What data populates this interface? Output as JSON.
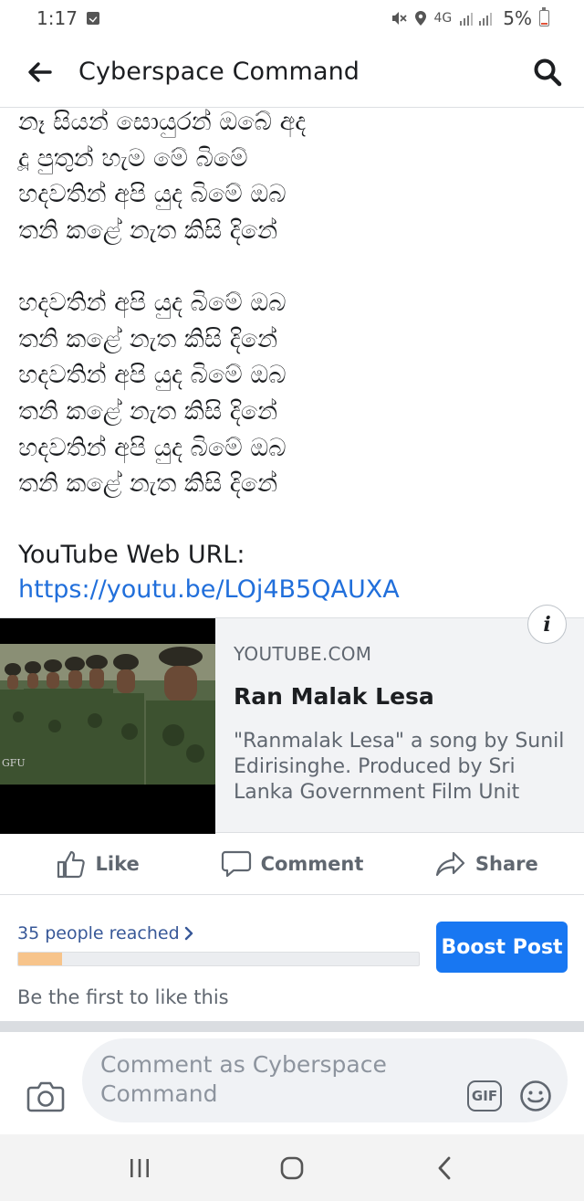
{
  "status_bar": {
    "time": "1:17",
    "battery": "5%",
    "network": "4G",
    "icons": [
      "checkbox-notification-icon",
      "mute-icon",
      "location-icon",
      "signal-icon",
      "battery-icon"
    ]
  },
  "app_bar": {
    "title": "Cyberspace Command",
    "back_icon": "arrow-left-icon",
    "search_icon": "search-icon"
  },
  "post": {
    "lines_part1": [
      "නෑ සියන් සොයුරන් ඔබේ අද",
      "දූ පුතුන් හැම මේ බිමේ",
      "හදවතින් අපි යුද බිමේ ඔබ",
      "තනි කළේ නැත කිසි දිනේ"
    ],
    "lines_part2": [
      "හදවතින් අපි යුද බිමේ ඔබ",
      "තනි කළේ නැත කිසි දිනේ",
      "හදවතින් අපි යුද බිමේ ඔබ",
      "තනි කළේ නැත කිසි දිනේ",
      "හදවතින් අපි යුද බිමේ ඔබ",
      "තනි කළේ නැත කිසි දිනේ"
    ],
    "youtube_label": "YouTube Web URL:",
    "youtube_url": "https://youtu.be/LOj4B5QAUXA"
  },
  "link_card": {
    "domain": "YOUTUBE.COM",
    "title": "Ran Malak Lesa",
    "description": "\"Ranmalak Lesa\" a song by Sunil Edirisinghe. Produced by Sri Lanka Government Film Unit",
    "thumbnail_watermark": "GFU",
    "info_label": "i"
  },
  "actions": {
    "like": "Like",
    "comment": "Comment",
    "share": "Share"
  },
  "insights": {
    "reach_text": "35 people reached",
    "reach_fraction": 0.11,
    "boost_label": "Boost Post",
    "first_like": "Be the first to like this"
  },
  "comment_box": {
    "placeholder": "Comment as Cyberspace Command",
    "gif_label": "GIF"
  },
  "colors": {
    "link": "#216fdb",
    "boost": "#1877f2",
    "progress_fill": "#f7c48b"
  }
}
